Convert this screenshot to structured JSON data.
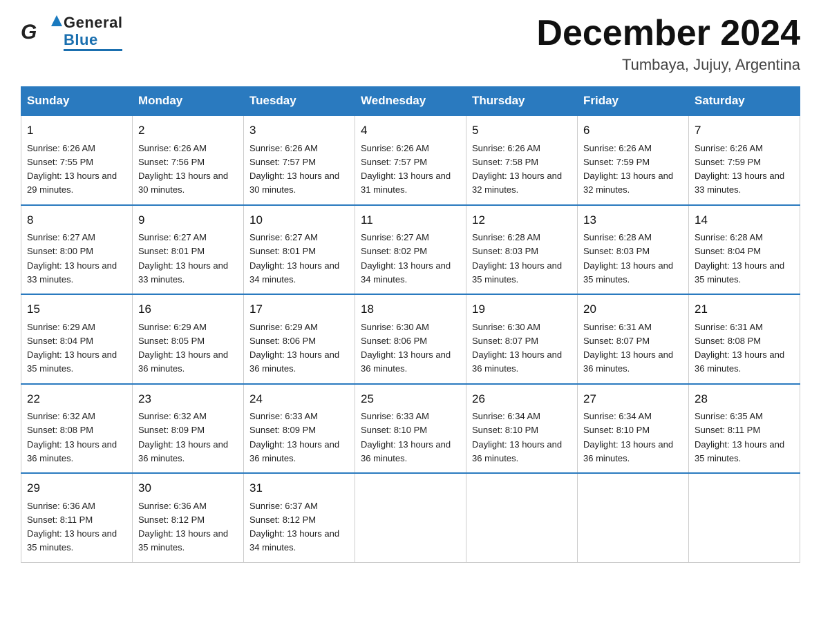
{
  "header": {
    "logo_general": "General",
    "logo_blue": "Blue",
    "main_title": "December 2024",
    "subtitle": "Tumbaya, Jujuy, Argentina"
  },
  "days_of_week": [
    "Sunday",
    "Monday",
    "Tuesday",
    "Wednesday",
    "Thursday",
    "Friday",
    "Saturday"
  ],
  "weeks": [
    [
      {
        "day": "1",
        "sunrise": "6:26 AM",
        "sunset": "7:55 PM",
        "daylight": "13 hours and 29 minutes."
      },
      {
        "day": "2",
        "sunrise": "6:26 AM",
        "sunset": "7:56 PM",
        "daylight": "13 hours and 30 minutes."
      },
      {
        "day": "3",
        "sunrise": "6:26 AM",
        "sunset": "7:57 PM",
        "daylight": "13 hours and 30 minutes."
      },
      {
        "day": "4",
        "sunrise": "6:26 AM",
        "sunset": "7:57 PM",
        "daylight": "13 hours and 31 minutes."
      },
      {
        "day": "5",
        "sunrise": "6:26 AM",
        "sunset": "7:58 PM",
        "daylight": "13 hours and 32 minutes."
      },
      {
        "day": "6",
        "sunrise": "6:26 AM",
        "sunset": "7:59 PM",
        "daylight": "13 hours and 32 minutes."
      },
      {
        "day": "7",
        "sunrise": "6:26 AM",
        "sunset": "7:59 PM",
        "daylight": "13 hours and 33 minutes."
      }
    ],
    [
      {
        "day": "8",
        "sunrise": "6:27 AM",
        "sunset": "8:00 PM",
        "daylight": "13 hours and 33 minutes."
      },
      {
        "day": "9",
        "sunrise": "6:27 AM",
        "sunset": "8:01 PM",
        "daylight": "13 hours and 33 minutes."
      },
      {
        "day": "10",
        "sunrise": "6:27 AM",
        "sunset": "8:01 PM",
        "daylight": "13 hours and 34 minutes."
      },
      {
        "day": "11",
        "sunrise": "6:27 AM",
        "sunset": "8:02 PM",
        "daylight": "13 hours and 34 minutes."
      },
      {
        "day": "12",
        "sunrise": "6:28 AM",
        "sunset": "8:03 PM",
        "daylight": "13 hours and 35 minutes."
      },
      {
        "day": "13",
        "sunrise": "6:28 AM",
        "sunset": "8:03 PM",
        "daylight": "13 hours and 35 minutes."
      },
      {
        "day": "14",
        "sunrise": "6:28 AM",
        "sunset": "8:04 PM",
        "daylight": "13 hours and 35 minutes."
      }
    ],
    [
      {
        "day": "15",
        "sunrise": "6:29 AM",
        "sunset": "8:04 PM",
        "daylight": "13 hours and 35 minutes."
      },
      {
        "day": "16",
        "sunrise": "6:29 AM",
        "sunset": "8:05 PM",
        "daylight": "13 hours and 36 minutes."
      },
      {
        "day": "17",
        "sunrise": "6:29 AM",
        "sunset": "8:06 PM",
        "daylight": "13 hours and 36 minutes."
      },
      {
        "day": "18",
        "sunrise": "6:30 AM",
        "sunset": "8:06 PM",
        "daylight": "13 hours and 36 minutes."
      },
      {
        "day": "19",
        "sunrise": "6:30 AM",
        "sunset": "8:07 PM",
        "daylight": "13 hours and 36 minutes."
      },
      {
        "day": "20",
        "sunrise": "6:31 AM",
        "sunset": "8:07 PM",
        "daylight": "13 hours and 36 minutes."
      },
      {
        "day": "21",
        "sunrise": "6:31 AM",
        "sunset": "8:08 PM",
        "daylight": "13 hours and 36 minutes."
      }
    ],
    [
      {
        "day": "22",
        "sunrise": "6:32 AM",
        "sunset": "8:08 PM",
        "daylight": "13 hours and 36 minutes."
      },
      {
        "day": "23",
        "sunrise": "6:32 AM",
        "sunset": "8:09 PM",
        "daylight": "13 hours and 36 minutes."
      },
      {
        "day": "24",
        "sunrise": "6:33 AM",
        "sunset": "8:09 PM",
        "daylight": "13 hours and 36 minutes."
      },
      {
        "day": "25",
        "sunrise": "6:33 AM",
        "sunset": "8:10 PM",
        "daylight": "13 hours and 36 minutes."
      },
      {
        "day": "26",
        "sunrise": "6:34 AM",
        "sunset": "8:10 PM",
        "daylight": "13 hours and 36 minutes."
      },
      {
        "day": "27",
        "sunrise": "6:34 AM",
        "sunset": "8:10 PM",
        "daylight": "13 hours and 36 minutes."
      },
      {
        "day": "28",
        "sunrise": "6:35 AM",
        "sunset": "8:11 PM",
        "daylight": "13 hours and 35 minutes."
      }
    ],
    [
      {
        "day": "29",
        "sunrise": "6:36 AM",
        "sunset": "8:11 PM",
        "daylight": "13 hours and 35 minutes."
      },
      {
        "day": "30",
        "sunrise": "6:36 AM",
        "sunset": "8:12 PM",
        "daylight": "13 hours and 35 minutes."
      },
      {
        "day": "31",
        "sunrise": "6:37 AM",
        "sunset": "8:12 PM",
        "daylight": "13 hours and 34 minutes."
      },
      null,
      null,
      null,
      null
    ]
  ],
  "labels": {
    "sunrise": "Sunrise:",
    "sunset": "Sunset:",
    "daylight": "Daylight:"
  }
}
